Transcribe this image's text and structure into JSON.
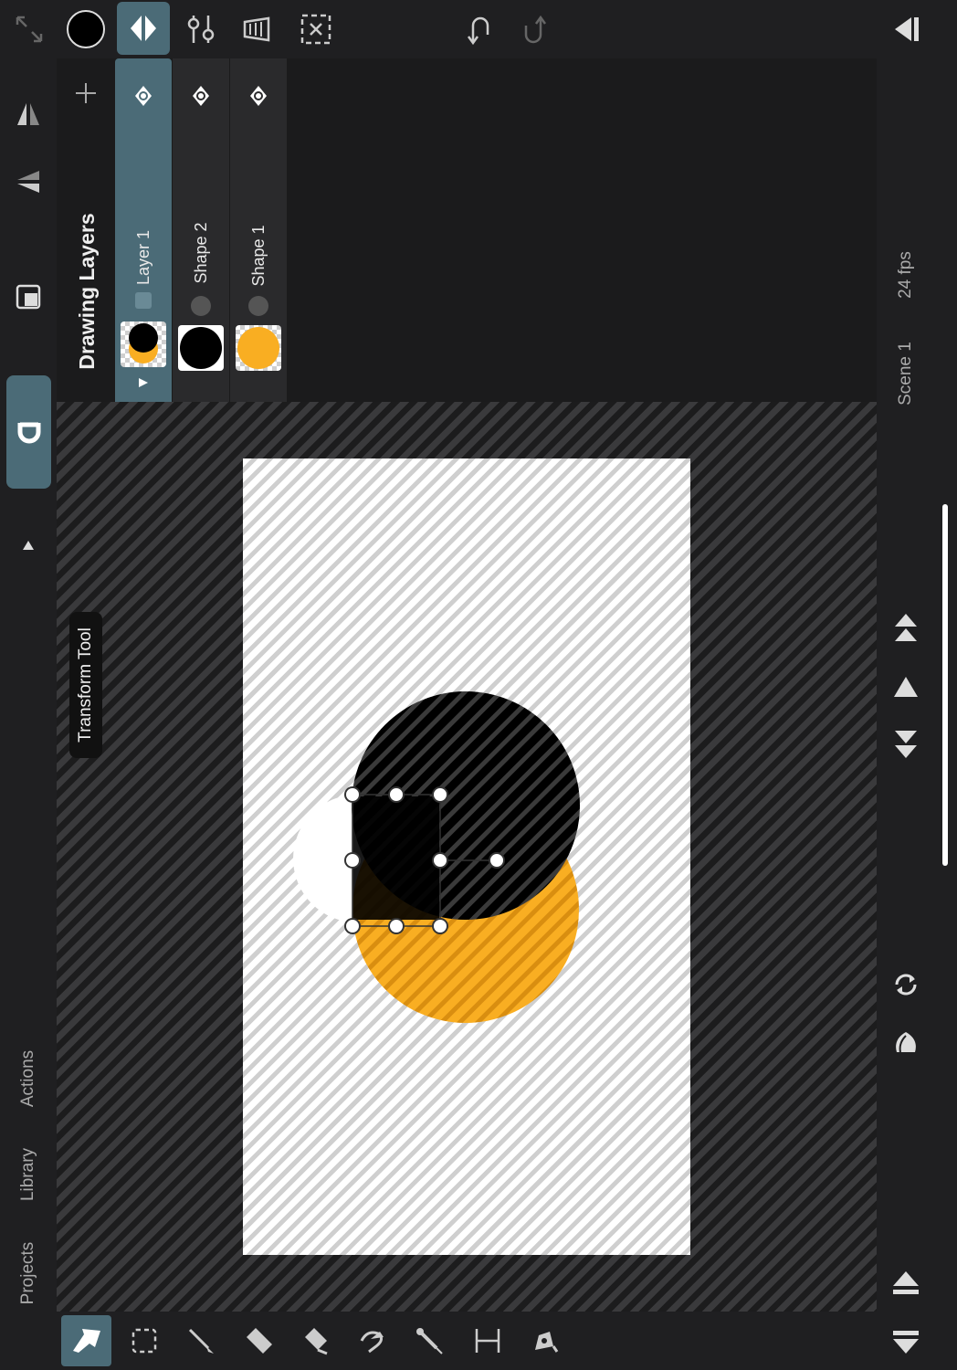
{
  "colors": {
    "accent": "#4b6b77",
    "orange": "#f9ae22",
    "black": "#000000",
    "white": "#ffffff"
  },
  "toolbar": {
    "expand_icon": "expand-arrows-icon",
    "color_swatch": "#000000",
    "undo_icon": "undo-icon",
    "redo_icon": "redo-icon",
    "collapse_icon": "collapse-panel-icon"
  },
  "layers_panel": {
    "title": "Drawing Layers",
    "layers": [
      {
        "name": "Layer 1",
        "active": true
      },
      {
        "name": "Shape 2",
        "active": false
      },
      {
        "name": "Shape 1",
        "active": false
      }
    ]
  },
  "tooltip": {
    "text": "Transform Tool"
  },
  "left_rail": {
    "actions_label": "Actions",
    "library_label": "Library",
    "projects_label": "Projects"
  },
  "right_rail": {
    "fps_label": "24 fps",
    "scene_label": "Scene 1"
  },
  "bottom_tools": [
    "transform-tool-icon",
    "selection-tool-icon",
    "brush-tool-icon",
    "eraser-tool-icon",
    "fill-tool-icon",
    "lasso-fill-tool-icon",
    "eyedropper-tool-icon",
    "guide-tool-icon",
    "pen-tool-icon"
  ]
}
